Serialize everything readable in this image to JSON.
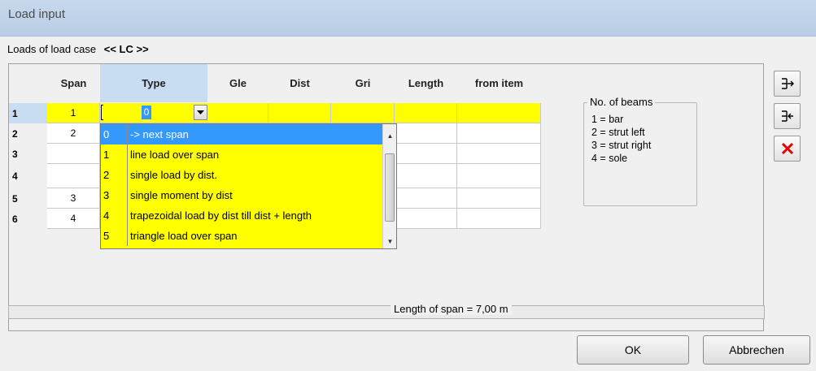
{
  "window": {
    "title": "Load input"
  },
  "header": {
    "loads_label": "Loads of load case",
    "load_case": "<< LC >>"
  },
  "grid": {
    "columns": [
      "Span",
      "Type",
      "Gle",
      "Dist",
      "Gri",
      "Length",
      "from item"
    ],
    "rows": [
      {
        "num": "1",
        "span": "1"
      },
      {
        "num": "2",
        "span": "2"
      },
      {
        "num": "3",
        "span": ""
      },
      {
        "num": "4",
        "span": ""
      },
      {
        "num": "5",
        "span": "3"
      },
      {
        "num": "6",
        "span": "4"
      }
    ],
    "type_editor_value": "0"
  },
  "type_dropdown": {
    "items": [
      {
        "code": "0",
        "text": "-> next span",
        "selected": true
      },
      {
        "code": "1",
        "text": "line load over span"
      },
      {
        "code": "2",
        "text": "single load by dist."
      },
      {
        "code": "3",
        "text": "single moment by dist"
      },
      {
        "code": "4",
        "text": "trapezoidal load by dist till dist + length"
      },
      {
        "code": "5",
        "text": "triangle load over span"
      }
    ]
  },
  "beams": {
    "title": "No. of beams",
    "items": [
      "1 = bar",
      "2  = strut left",
      "3  = strut right",
      "4  = sole"
    ]
  },
  "side_buttons": [
    {
      "icon": "insert-row-icon"
    },
    {
      "icon": "delete-row-icon"
    },
    {
      "icon": "delete-icon"
    }
  ],
  "status": {
    "text": "Length of span = 7,00 m"
  },
  "buttons": {
    "ok": "OK",
    "cancel": "Abbrechen"
  },
  "colors": {
    "edit_row": "#ffff00",
    "selection": "#3399ff",
    "header_selected": "#c9ddf2",
    "delete": "#e00000"
  }
}
